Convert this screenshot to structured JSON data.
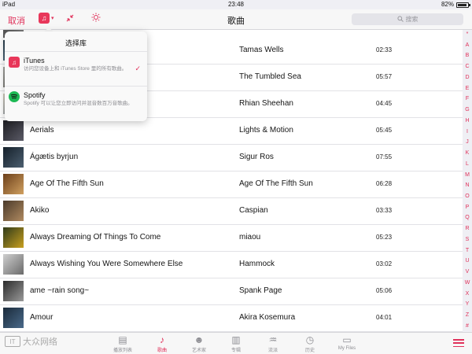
{
  "status": {
    "device": "iPad",
    "time": "23:48",
    "battery": "82%",
    "battery_level": 0.82
  },
  "nav": {
    "cancel": "取消",
    "title": "歌曲",
    "search_placeholder": "搜索"
  },
  "popover": {
    "title": "选择库",
    "items": [
      {
        "name": "iTunes",
        "desc": "访问您设备上和 iTunes Store 里的所有歌曲。",
        "selected": true
      },
      {
        "name": "Spotify",
        "desc": "Spotify 可以让您立即访问并混音数百万音歌曲。",
        "selected": false
      }
    ]
  },
  "songs": [
    {
      "title": "",
      "artist": "",
      "duration": ""
    },
    {
      "title": "",
      "artist": "Tamas Wells",
      "duration": "02:33"
    },
    {
      "title": "",
      "artist": "The Tumbled Sea",
      "duration": "05:57"
    },
    {
      "title": "",
      "artist": "Rhian Sheehan",
      "duration": "04:45"
    },
    {
      "title": "Aerials",
      "artist": "Lights & Motion",
      "duration": "05:45"
    },
    {
      "title": "Ágætis byrjun",
      "artist": "Sigur Ros",
      "duration": "07:55"
    },
    {
      "title": "Age Of The Fifth Sun",
      "artist": "Age Of The Fifth Sun",
      "duration": "06:28"
    },
    {
      "title": "Akiko",
      "artist": "Caspian",
      "duration": "03:33"
    },
    {
      "title": "Always Dreaming Of Things To Come",
      "artist": "miaou",
      "duration": "05:23"
    },
    {
      "title": "Always Wishing You Were Somewhere Else",
      "artist": "Hammock",
      "duration": "03:02"
    },
    {
      "title": "ame ~rain song~",
      "artist": "Spank Page",
      "duration": "05:06"
    },
    {
      "title": "Amour",
      "artist": "Akira Kosemura",
      "duration": "04:01"
    }
  ],
  "index_letters": [
    "*",
    "A",
    "B",
    "C",
    "D",
    "E",
    "F",
    "G",
    "H",
    "I",
    "J",
    "K",
    "L",
    "M",
    "N",
    "O",
    "P",
    "Q",
    "R",
    "S",
    "T",
    "U",
    "V",
    "W",
    "X",
    "Y",
    "Z",
    "#"
  ],
  "tabs": [
    {
      "label": "播放列表",
      "icon": "playlist-icon",
      "active": false
    },
    {
      "label": "歌曲",
      "icon": "music-note-icon",
      "active": true
    },
    {
      "label": "艺术家",
      "icon": "artist-icon",
      "active": false
    },
    {
      "label": "专辑",
      "icon": "album-icon",
      "active": false
    },
    {
      "label": "流派",
      "icon": "genre-icon",
      "active": false
    },
    {
      "label": "历史",
      "icon": "history-icon",
      "active": false
    },
    {
      "label": "My Files",
      "icon": "folder-icon",
      "active": false
    }
  ],
  "watermark": {
    "logo_text": "IT",
    "text": "大众网络"
  },
  "colors": {
    "accent": "#e0315a",
    "spotify": "#1db954",
    "itunes": "#e8375a"
  }
}
